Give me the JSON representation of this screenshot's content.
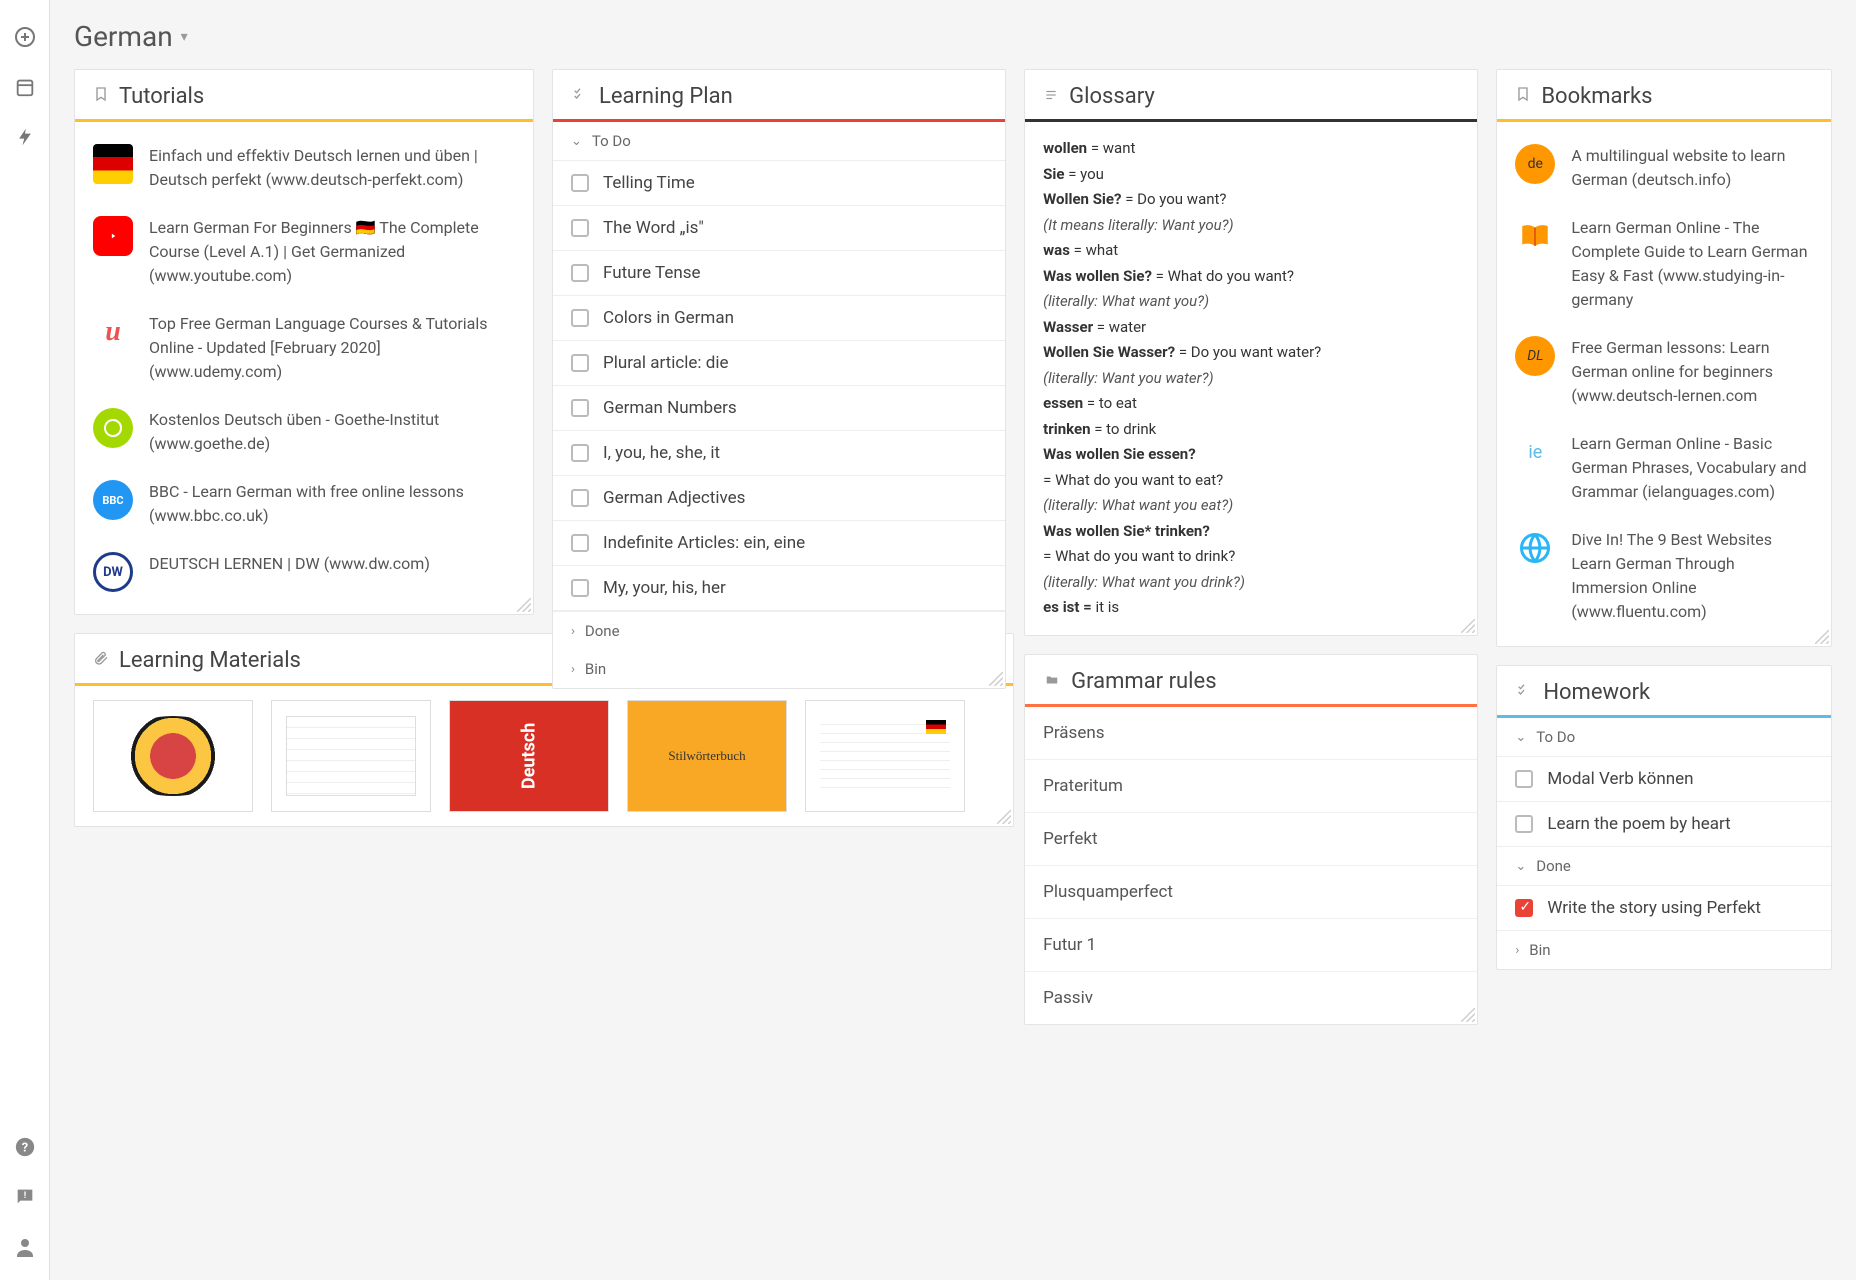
{
  "page": {
    "title": "German"
  },
  "tutorials": {
    "title": "Tutorials",
    "items": [
      "Einfach und effektiv Deutsch lernen und üben | Deutsch perfekt (www.deutsch-perfekt.com)",
      "Learn German For Beginners 🇩🇪 The Complete Course (Level A.1) | Get Germanized (www.youtube.com)",
      "Top Free German Language Courses & Tutorials Online - Updated [February 2020] (www.udemy.com)",
      "Kostenlos Deutsch üben - Goethe-Institut (www.goethe.de)",
      "BBC - Learn German with free online lessons (www.bbc.co.uk)",
      "DEUTSCH LERNEN | DW (www.dw.com)"
    ]
  },
  "learning_plan": {
    "title": "Learning Plan",
    "sections": {
      "todo": "To Do",
      "done": "Done",
      "bin": "Bin"
    },
    "tasks": [
      "Telling Time",
      "The Word „is\"",
      "Future Tense",
      "Colors in German",
      "Plural article: die",
      "German Numbers",
      "I, you, he, she, it",
      "German Adjectives",
      "Indefinite Articles: ein, eine",
      "My, your, his, her"
    ]
  },
  "glossary": {
    "title": "Glossary",
    "lines": [
      {
        "b": "wollen",
        "t": " = want"
      },
      {
        "b": "Sie",
        "t": " = you"
      },
      {
        "b": "Wollen Sie?",
        "t": " = Do you want?"
      },
      {
        "i": "(It means literally: Want you?)"
      },
      {
        "b": "was",
        "t": " = what"
      },
      {
        "b": "Was wollen Sie?",
        "t": " = What do you want?"
      },
      {
        "i": "(literally: What want you?)"
      },
      {
        "b": "Wasser",
        "t": " = water"
      },
      {
        "b": "Wollen Sie Wasser?",
        "t": " = Do you want water?"
      },
      {
        "i": "(literally: Want you water?)"
      },
      {
        "b": "essen",
        "t": " = to eat"
      },
      {
        "b": "trinken",
        "t": " = to drink"
      },
      {
        "b": "Was wollen Sie essen?",
        "t": ""
      },
      {
        "t": "= What do you want to eat?"
      },
      {
        "i": "(literally: What want you eat?)"
      },
      {
        "b": "Was wollen Sie* trinken?",
        "t": ""
      },
      {
        "t": "= What do you want to drink?"
      },
      {
        "i": "(literally: What want you drink?)"
      },
      {
        "b": "es ist =",
        "t": " it is"
      }
    ]
  },
  "grammar": {
    "title": "Grammar rules",
    "items": [
      "Präsens",
      "Prateritum",
      "Perfekt",
      "Plusquamperfect",
      "Futur 1",
      "Passiv"
    ]
  },
  "bookmarks": {
    "title": "Bookmarks",
    "items": [
      "A multilingual website to learn German (deutsch.info)",
      "Learn German Online - The Complete Guide to Learn German Easy & Fast (www.studying-in-germany",
      "Free German lessons: Learn German online for beginners (www.deutsch-lernen.com",
      "Learn German Online - Basic German Phrases, Vocabulary and Grammar (ielanguages.com)",
      "Dive In! The 9 Best Websites Learn German Through Immersion Online (www.fluentu.com)"
    ]
  },
  "homework": {
    "title": "Homework",
    "sections": {
      "todo": "To Do",
      "done": "Done",
      "bin": "Bin"
    },
    "todo_tasks": [
      "Modal Verb können",
      "Learn the poem by heart"
    ],
    "done_tasks": [
      "Write the story using Perfekt"
    ]
  },
  "materials": {
    "title": "Learning Materials",
    "thumb3": "Deutsch",
    "thumb4": "Stilwörterbuch"
  }
}
